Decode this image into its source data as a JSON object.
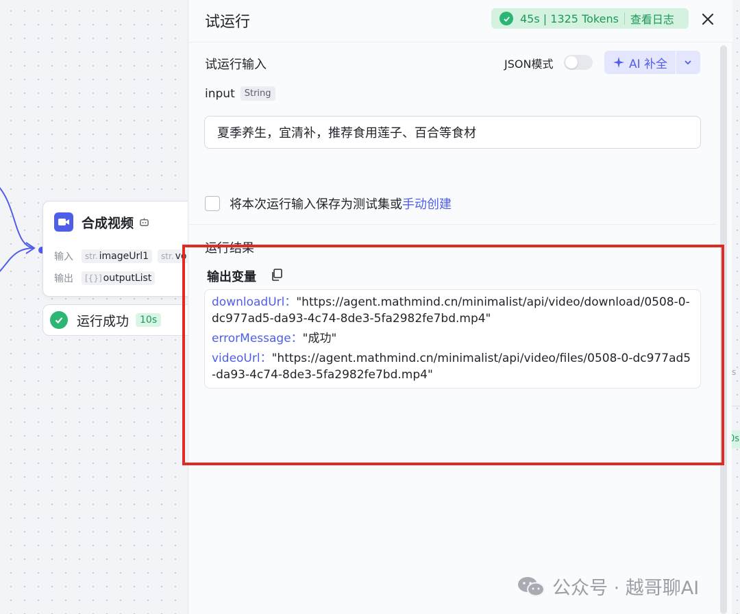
{
  "canvas": {
    "node": {
      "title": "合成视频",
      "input_label": "输入",
      "output_label": "输出",
      "inputs": [
        {
          "prefix": "str.",
          "name": "imageUrl1"
        },
        {
          "prefix": "str.",
          "name": "vo"
        }
      ],
      "outputs": [
        {
          "prefix": "[{}]",
          "name": "outputList"
        }
      ]
    },
    "status": {
      "text": "运行成功",
      "time": "10s"
    },
    "side_glimpse": {
      "s": "s",
      "tag": "0s"
    }
  },
  "panel": {
    "title": "试运行",
    "run_stats": "45s | 1325 Tokens",
    "view_logs": "查看日志",
    "input_section_title": "试运行输入",
    "json_mode_label": "JSON模式",
    "json_mode_on": false,
    "ai_fill_label": "AI 补全",
    "param": {
      "name": "input",
      "type": "String",
      "value": "夏季养生，宜清补，推荐食用莲子、百合等食材"
    },
    "save_text": "将本次运行输入保存为测试集或",
    "save_link": "手动创建",
    "result_section_title": "运行结果",
    "output_vars_label": "输出变量",
    "outputs": [
      {
        "key": "downloadUrl：",
        "value": "\"https://agent.mathmind.cn/minimalist/api/video/download/0508-0-dc977ad5-da93-4c74-8de3-5fa2982fe7bd.mp4\""
      },
      {
        "key": "errorMessage：",
        "value": "\"成功\""
      },
      {
        "key": "videoUrl：",
        "value": "\"https://agent.mathmind.cn/minimalist/api/video/files/0508-0-dc977ad5-da93-4c74-8de3-5fa2982fe7bd.mp4\""
      }
    ]
  },
  "watermark": {
    "text": "公众号 · 越哥聊AI"
  },
  "colors": {
    "accent": "#4e5ee9",
    "success": "#2bb673",
    "highlight_border": "#e02a24"
  }
}
